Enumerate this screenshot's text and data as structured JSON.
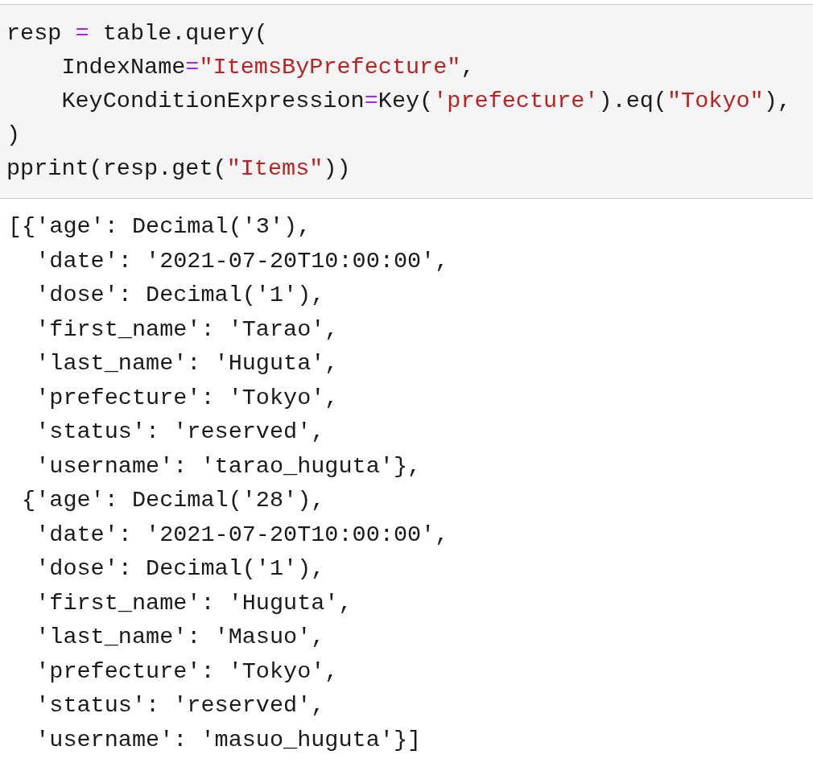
{
  "code_cell": {
    "lines": [
      [
        {
          "kind": "plain",
          "text": "resp "
        },
        {
          "kind": "operator",
          "text": "="
        },
        {
          "kind": "plain",
          "text": " table.query("
        }
      ],
      [
        {
          "kind": "plain",
          "text": "    IndexName"
        },
        {
          "kind": "operator",
          "text": "="
        },
        {
          "kind": "string",
          "text": "\"ItemsByPrefecture\""
        },
        {
          "kind": "plain",
          "text": ","
        }
      ],
      [
        {
          "kind": "plain",
          "text": "    KeyConditionExpression"
        },
        {
          "kind": "operator",
          "text": "="
        },
        {
          "kind": "plain",
          "text": "Key("
        },
        {
          "kind": "string",
          "text": "'prefecture'"
        },
        {
          "kind": "plain",
          "text": ").eq("
        },
        {
          "kind": "string",
          "text": "\"Tokyo\""
        },
        {
          "kind": "plain",
          "text": "),"
        }
      ],
      [
        {
          "kind": "plain",
          "text": ")"
        }
      ],
      [
        {
          "kind": "plain",
          "text": "pprint(resp.get("
        },
        {
          "kind": "string",
          "text": "\"Items\""
        },
        {
          "kind": "plain",
          "text": "))"
        }
      ]
    ]
  },
  "output": {
    "lines": [
      "[{'age': Decimal('3'),",
      "  'date': '2021-07-20T10:00:00',",
      "  'dose': Decimal('1'),",
      "  'first_name': 'Tarao',",
      "  'last_name': 'Huguta',",
      "  'prefecture': 'Tokyo',",
      "  'status': 'reserved',",
      "  'username': 'tarao_huguta'},",
      " {'age': Decimal('28'),",
      "  'date': '2021-07-20T10:00:00',",
      "  'dose': Decimal('1'),",
      "  'first_name': 'Huguta',",
      "  'last_name': 'Masuo',",
      "  'prefecture': 'Tokyo',",
      "  'status': 'reserved',",
      "  'username': 'masuo_huguta'}]"
    ]
  }
}
